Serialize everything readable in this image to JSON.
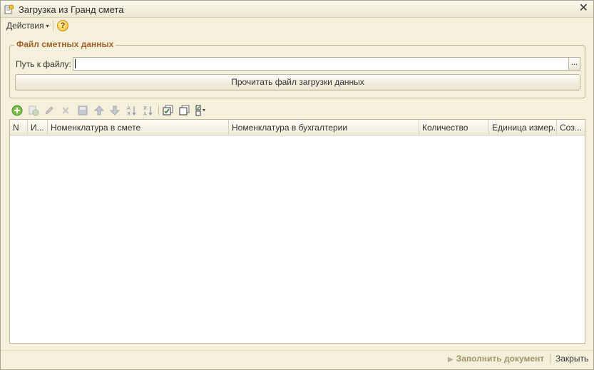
{
  "window": {
    "title": "Загрузка из Гранд смета",
    "close_glyph": "✕"
  },
  "menu": {
    "actions_label": "Действия",
    "actions_arrow": "▾",
    "help_glyph": "?"
  },
  "file_group": {
    "legend": "Файл сметных данных",
    "path_label": "Путь к файлу:",
    "path_value": "",
    "browse_label": "...",
    "read_button_label": "Прочитать файл загрузки данных"
  },
  "toolbar": {
    "icons": [
      "add-icon",
      "copy-icon",
      "edit-icon",
      "delete-icon",
      "save-icon",
      "move-up-icon",
      "move-down-icon",
      "sort-ascending-icon",
      "sort-descending-icon",
      "check-all-icon",
      "uncheck-all-icon",
      "toggle-check-icon"
    ]
  },
  "table": {
    "columns": [
      {
        "label": "N"
      },
      {
        "label": "И..."
      },
      {
        "label": "Номенклатура в смете"
      },
      {
        "label": "Номенклатура в бухгалтерии"
      },
      {
        "label": "Количество"
      },
      {
        "label": "Единица измер..."
      },
      {
        "label": "Соз..."
      }
    ],
    "rows": []
  },
  "footer": {
    "fill_button_label": "Заполнить документ",
    "close_button_label": "Закрыть"
  },
  "colors": {
    "window_bg": "#f4f0dc",
    "legend_color": "#a0622a",
    "disabled_text": "#a0936a"
  }
}
